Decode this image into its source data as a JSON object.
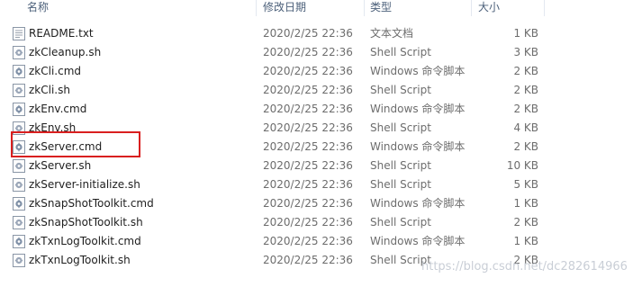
{
  "columns": {
    "name": "名称",
    "date": "修改日期",
    "type": "类型",
    "size": "大小"
  },
  "files": [
    {
      "name": "README.txt",
      "date": "2020/2/25 22:36",
      "type": "文本文档",
      "size": "1 KB",
      "icon": "text-file-icon"
    },
    {
      "name": "zkCleanup.sh",
      "date": "2020/2/25 22:36",
      "type": "Shell Script",
      "size": "3 KB",
      "icon": "script-file-icon"
    },
    {
      "name": "zkCli.cmd",
      "date": "2020/2/25 22:36",
      "type": "Windows 命令脚本",
      "size": "2 KB",
      "icon": "cmd-file-icon"
    },
    {
      "name": "zkCli.sh",
      "date": "2020/2/25 22:36",
      "type": "Shell Script",
      "size": "2 KB",
      "icon": "script-file-icon"
    },
    {
      "name": "zkEnv.cmd",
      "date": "2020/2/25 22:36",
      "type": "Windows 命令脚本",
      "size": "2 KB",
      "icon": "cmd-file-icon"
    },
    {
      "name": "zkEnv.sh",
      "date": "2020/2/25 22:36",
      "type": "Shell Script",
      "size": "4 KB",
      "icon": "script-file-icon"
    },
    {
      "name": "zkServer.cmd",
      "date": "2020/2/25 22:36",
      "type": "Windows 命令脚本",
      "size": "2 KB",
      "icon": "cmd-file-icon"
    },
    {
      "name": "zkServer.sh",
      "date": "2020/2/25 22:36",
      "type": "Shell Script",
      "size": "10 KB",
      "icon": "script-file-icon"
    },
    {
      "name": "zkServer-initialize.sh",
      "date": "2020/2/25 22:36",
      "type": "Shell Script",
      "size": "5 KB",
      "icon": "script-file-icon"
    },
    {
      "name": "zkSnapShotToolkit.cmd",
      "date": "2020/2/25 22:36",
      "type": "Windows 命令脚本",
      "size": "1 KB",
      "icon": "cmd-file-icon"
    },
    {
      "name": "zkSnapShotToolkit.sh",
      "date": "2020/2/25 22:36",
      "type": "Shell Script",
      "size": "2 KB",
      "icon": "script-file-icon"
    },
    {
      "name": "zkTxnLogToolkit.cmd",
      "date": "2020/2/25 22:36",
      "type": "Windows 命令脚本",
      "size": "1 KB",
      "icon": "cmd-file-icon"
    },
    {
      "name": "zkTxnLogToolkit.sh",
      "date": "2020/2/25 22:36",
      "type": "Shell Script",
      "size": "2 KB",
      "icon": "script-file-icon"
    }
  ],
  "highlight_color": "#d91f1f",
  "watermark": "https://blog.csdn.net/dc282614966"
}
